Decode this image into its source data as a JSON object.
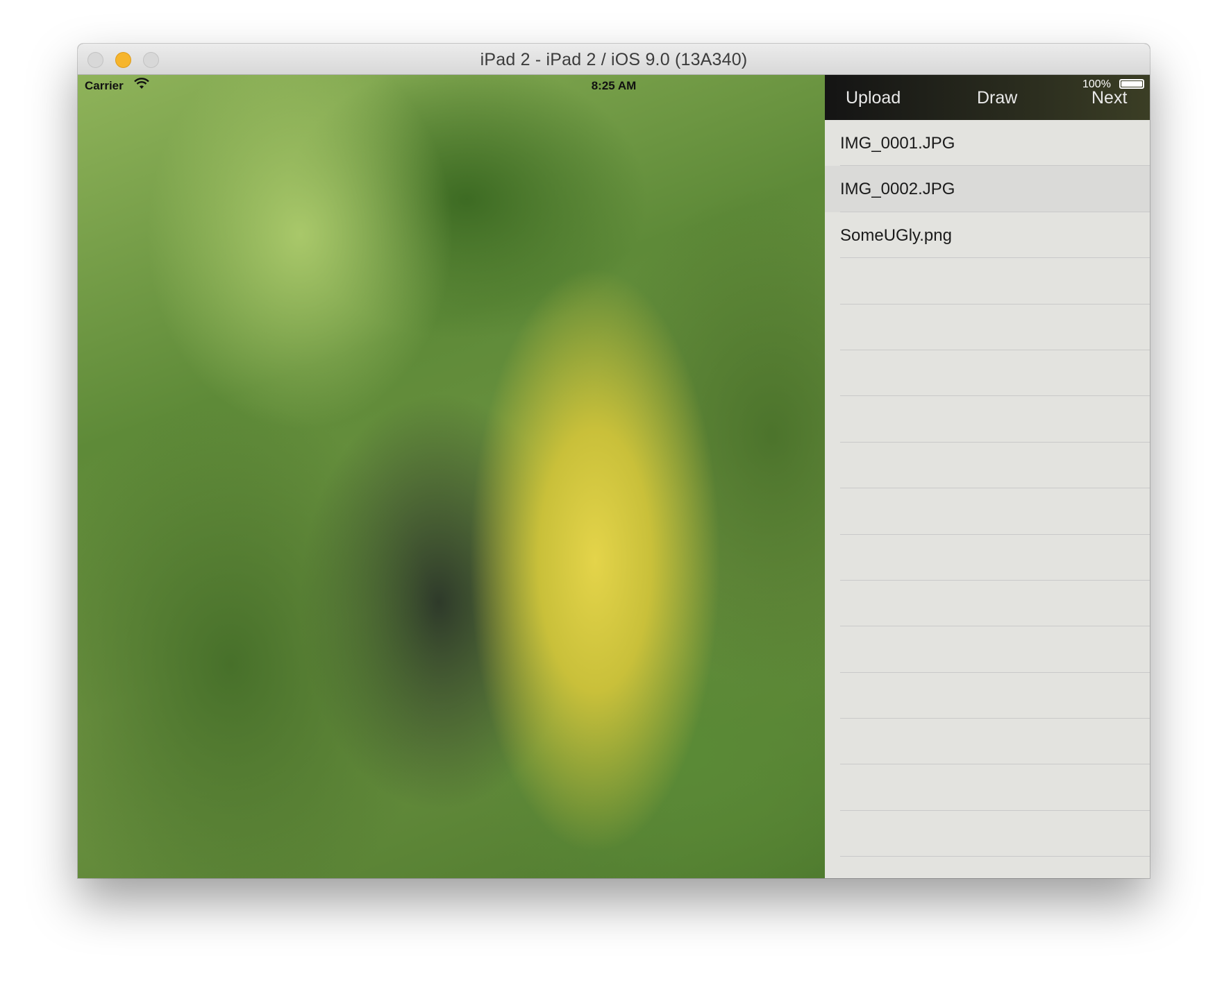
{
  "window": {
    "title": "iPad 2 - iPad 2 / iOS 9.0 (13A340)"
  },
  "statusbar": {
    "carrier": "Carrier",
    "time": "8:25 AM",
    "battery": "100%"
  },
  "toolbar": {
    "upload_label": "Upload",
    "draw_label": "Draw",
    "next_label": "Next"
  },
  "files": [
    {
      "name": "IMG_0001.JPG",
      "selected": false
    },
    {
      "name": "IMG_0002.JPG",
      "selected": true
    },
    {
      "name": "SomeUGly.png",
      "selected": false
    },
    {
      "name": "",
      "selected": false
    },
    {
      "name": "",
      "selected": false
    },
    {
      "name": "",
      "selected": false
    },
    {
      "name": "",
      "selected": false
    },
    {
      "name": "",
      "selected": false
    },
    {
      "name": "",
      "selected": false
    },
    {
      "name": "",
      "selected": false
    },
    {
      "name": "",
      "selected": false
    },
    {
      "name": "",
      "selected": false
    },
    {
      "name": "",
      "selected": false
    },
    {
      "name": "",
      "selected": false
    },
    {
      "name": "",
      "selected": false
    },
    {
      "name": "",
      "selected": false
    },
    {
      "name": "",
      "selected": false
    }
  ],
  "colors": {
    "minimize": "#f6b52d",
    "selected_row": "#dadad8"
  }
}
